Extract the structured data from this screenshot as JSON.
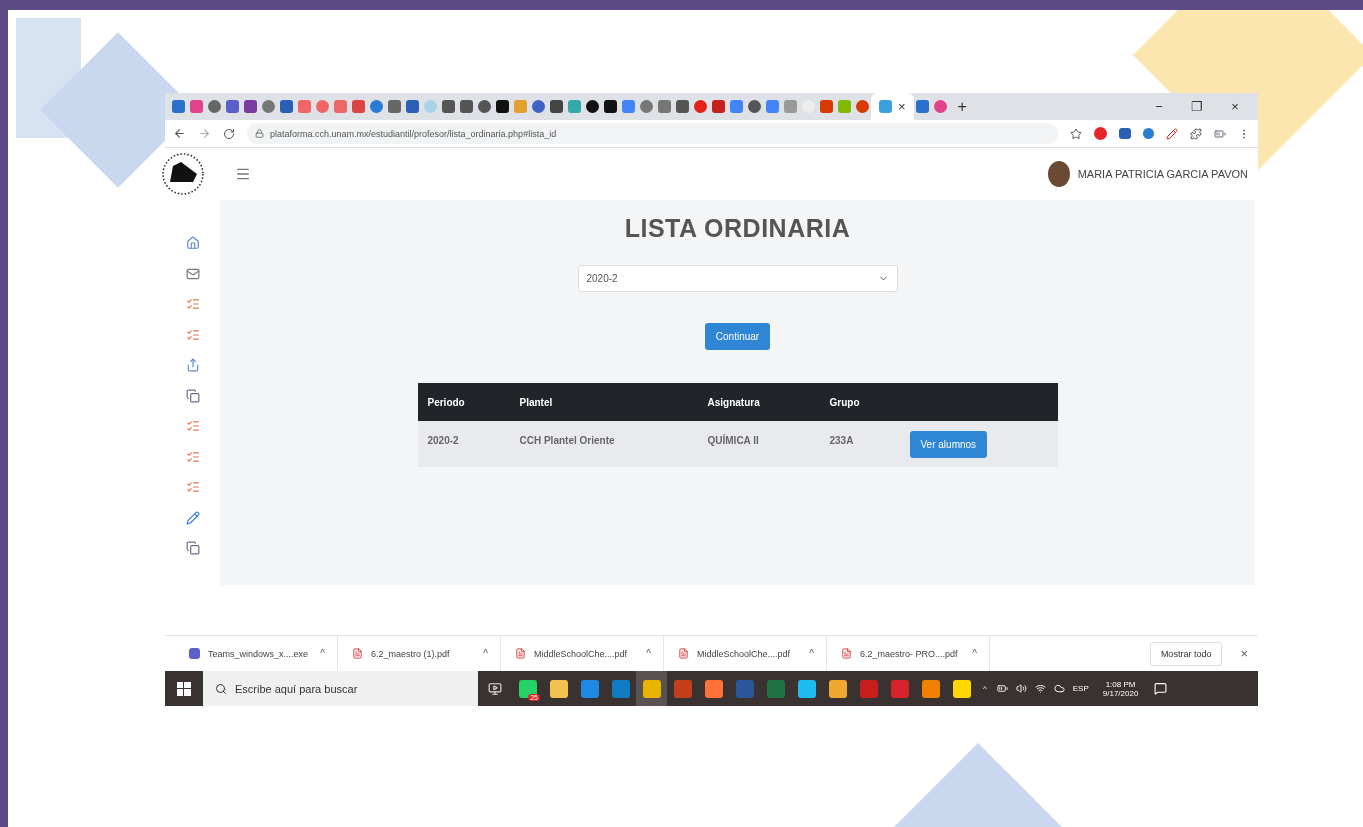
{
  "browser": {
    "tabs": [
      {
        "selected": false
      },
      {
        "selected": false
      },
      {
        "selected": false
      },
      {
        "selected": false
      },
      {
        "selected": false
      },
      {
        "selected": false
      },
      {
        "selected": false
      },
      {
        "selected": false
      },
      {
        "selected": false
      },
      {
        "selected": false
      },
      {
        "selected": false
      },
      {
        "selected": false
      },
      {
        "selected": false
      },
      {
        "selected": false
      },
      {
        "selected": false
      },
      {
        "selected": false
      },
      {
        "selected": false
      },
      {
        "selected": false
      },
      {
        "selected": false
      },
      {
        "selected": false
      },
      {
        "selected": false
      },
      {
        "selected": false
      },
      {
        "selected": false
      },
      {
        "selected": false
      },
      {
        "selected": false
      },
      {
        "selected": false
      },
      {
        "selected": false
      },
      {
        "selected": false
      },
      {
        "selected": false
      },
      {
        "selected": false
      },
      {
        "selected": false
      },
      {
        "selected": false
      },
      {
        "selected": false
      },
      {
        "selected": false
      },
      {
        "selected": false
      },
      {
        "selected": false
      },
      {
        "selected": false
      },
      {
        "selected": false
      },
      {
        "selected": false
      },
      {
        "selected": true,
        "close": "×"
      },
      {
        "selected": false
      },
      {
        "selected": false
      }
    ],
    "new_tab": "+",
    "window_controls": [
      "−",
      "❐",
      "×"
    ],
    "url": "plataforma.cch.unam.mx/estudiantil/profesor/lista_ordinaria.php#lista_id"
  },
  "header": {
    "user_name": "MARIA PATRICIA GARCIA PAVON"
  },
  "sidebar": {
    "items": [
      {
        "kind": "home"
      },
      {
        "kind": "mail"
      },
      {
        "kind": "list"
      },
      {
        "kind": "list"
      },
      {
        "kind": "share"
      },
      {
        "kind": "copy"
      },
      {
        "kind": "list"
      },
      {
        "kind": "list"
      },
      {
        "kind": "list"
      },
      {
        "kind": "pencil"
      },
      {
        "kind": "copy"
      }
    ]
  },
  "main": {
    "title": "LISTA ORDINARIA",
    "period_select": {
      "value": "2020-2"
    },
    "continue_button": "Continuar",
    "table": {
      "columns": [
        "Periodo",
        "Plantel",
        "Asignatura",
        "Grupo"
      ],
      "rows": [
        {
          "cells": [
            "2020-2",
            "CCH Plantel Oriente",
            "QUÍMICA II",
            "233A"
          ],
          "action": "Ver alumnos"
        }
      ]
    }
  },
  "downloads": {
    "items": [
      {
        "kind": "app",
        "name": "Teams_windows_x....exe"
      },
      {
        "kind": "pdf",
        "name": "6.2_maestro (1).pdf"
      },
      {
        "kind": "pdf",
        "name": "MiddleSchoolChe....pdf"
      },
      {
        "kind": "pdf",
        "name": "MiddleSchoolChe....pdf"
      },
      {
        "kind": "pdf",
        "name": "6.2_maestro- PRO....pdf"
      }
    ],
    "caret": "^",
    "show_all": "Mostrar todo",
    "close": "×"
  },
  "taskbar": {
    "search_placeholder": "Escribe aquí para buscar",
    "apps": [
      {
        "kind": "whatsapp",
        "badge": "25",
        "selected": false
      },
      {
        "kind": "files",
        "selected": false
      },
      {
        "kind": "mail",
        "selected": false
      },
      {
        "kind": "edge",
        "selected": false
      },
      {
        "kind": "chrome",
        "selected": true
      },
      {
        "kind": "powerpoint",
        "selected": false
      },
      {
        "kind": "firefox",
        "selected": false
      },
      {
        "kind": "word",
        "selected": false
      },
      {
        "kind": "excel",
        "selected": false
      },
      {
        "kind": "ie",
        "selected": false
      },
      {
        "kind": "media",
        "selected": false
      },
      {
        "kind": "acrobat",
        "selected": false
      },
      {
        "kind": "avira",
        "selected": false
      },
      {
        "kind": "vlc",
        "selected": false
      },
      {
        "kind": "notes",
        "selected": false
      }
    ],
    "tray_caret": "^",
    "language": "ESP",
    "time": "1:08 PM",
    "date": "9/17/2020"
  }
}
